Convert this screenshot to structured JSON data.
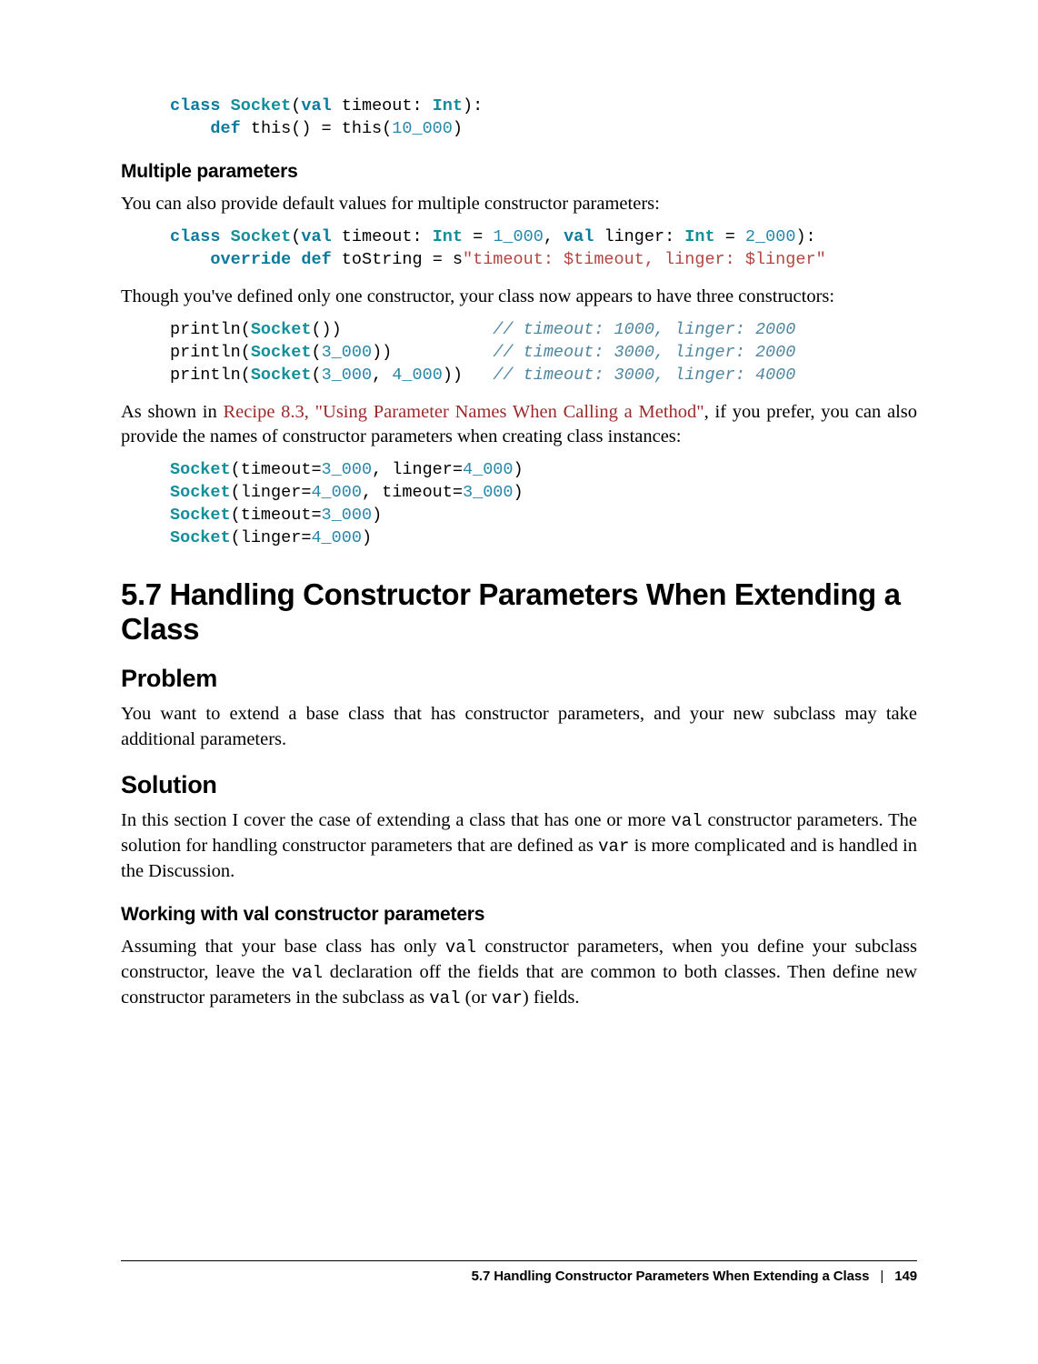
{
  "code1": {
    "l1_class": "class",
    "l1_socket": "Socket",
    "l1_open": "(",
    "l1_val": "val",
    "l1_timeout": " timeout: ",
    "l1_int": "Int",
    "l1_close": "):",
    "l2_indent": "    ",
    "l2_def": "def",
    "l2_rest": " this() = this(",
    "l2_num": "10_000",
    "l2_end": ")"
  },
  "h_multi": "Multiple parameters",
  "p_multi": "You can also provide default values for multiple constructor parameters:",
  "code2": {
    "l1_class": "class",
    "l1_sp": " ",
    "l1_socket": "Socket",
    "l1_open": "(",
    "l1_val1": "val",
    "l1_t": " timeout: ",
    "l1_int1": "Int",
    "l1_eq1": " = ",
    "l1_n1": "1_000",
    "l1_c": ", ",
    "l1_val2": "val",
    "l1_l": " linger: ",
    "l1_int2": "Int",
    "l1_eq2": " = ",
    "l1_n2": "2_000",
    "l1_close": "):",
    "l2_indent": "    ",
    "l2_override": "override",
    "l2_sp": " ",
    "l2_def": "def",
    "l2_ts": " toString = s",
    "l2_str": "\"timeout: $timeout, linger: $linger\""
  },
  "p_though": "Though you've defined only one constructor, your class now appears to have three constructors:",
  "code3": {
    "l1a": "println(",
    "l1s": "Socket",
    "l1b": "())               ",
    "l1c": "// timeout: 1000, linger: 2000",
    "l2a": "println(",
    "l2s": "Socket",
    "l2b": "(",
    "l2n": "3_000",
    "l2e": "))          ",
    "l2c": "// timeout: 3000, linger: 2000",
    "l3a": "println(",
    "l3s": "Socket",
    "l3b": "(",
    "l3n1": "3_000",
    "l3m": ", ",
    "l3n2": "4_000",
    "l3e": "))   ",
    "l3c": "// timeout: 3000, linger: 4000"
  },
  "p_asshown_pre": "As shown in ",
  "p_asshown_link": "Recipe 8.3, \"Using Parameter Names When Calling a Method\"",
  "p_asshown_post": ", if you prefer, you can also provide the names of constructor parameters when creating class instances:",
  "code4": {
    "l1s": "Socket",
    "l1a": "(timeout=",
    "l1n1": "3_000",
    "l1b": ", linger=",
    "l1n2": "4_000",
    "l1c": ")",
    "l2s": "Socket",
    "l2a": "(linger=",
    "l2n1": "4_000",
    "l2b": ", timeout=",
    "l2n2": "3_000",
    "l2c": ")",
    "l3s": "Socket",
    "l3a": "(timeout=",
    "l3n": "3_000",
    "l3c": ")",
    "l4s": "Socket",
    "l4a": "(linger=",
    "l4n": "4_000",
    "l4c": ")"
  },
  "h_section": "5.7 Handling Constructor Parameters When Extending a Class",
  "h_problem": "Problem",
  "p_problem": "You want to extend a base class that has constructor parameters, and your new subclass may take additional parameters.",
  "h_solution": "Solution",
  "p_solution_pre": "In this section I cover the case of extending a class that has one or more ",
  "c_val": "val",
  "p_solution_mid": " constructor parameters. The solution for handling constructor parameters that are defined as ",
  "c_var": "var",
  "p_solution_end": " is more complicated and is handled in the Discussion.",
  "h_working": "Working with val constructor parameters",
  "p_working_1": "Assuming that your base class has only ",
  "p_working_2": " constructor parameters, when you define your subclass constructor, leave the ",
  "p_working_3": " declaration off the fields that are common to both classes. Then define new constructor parameters in the subclass as ",
  "p_working_4": " (or ",
  "p_working_5": ") fields.",
  "footer_title": "5.7 Handling Constructor Parameters When Extending a Class",
  "footer_sep": "|",
  "footer_page": "149"
}
